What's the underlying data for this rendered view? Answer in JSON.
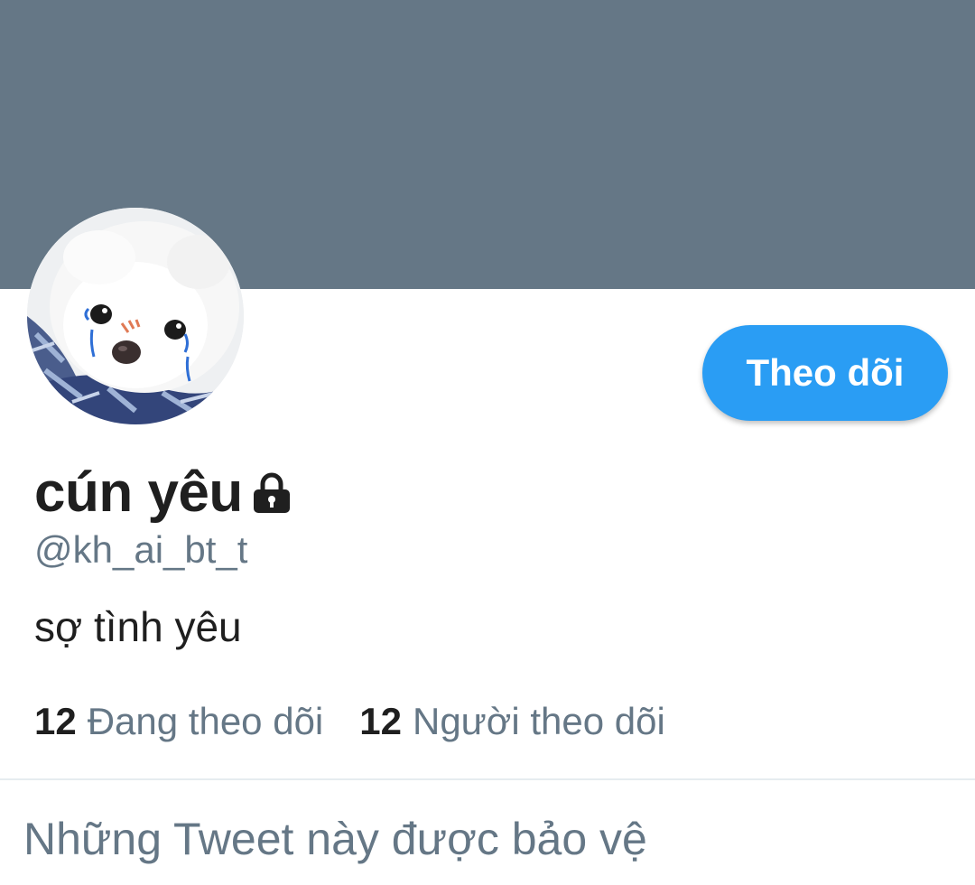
{
  "profile": {
    "display_name": "cún yêu",
    "handle": "@kh_ai_bt_t",
    "bio": "sợ tình yêu",
    "locked_icon": "lock-icon",
    "avatar_icon": "avatar-photo"
  },
  "actions": {
    "follow_label": "Theo dõi"
  },
  "stats": {
    "following_count": "12",
    "following_label": "Đang theo dõi",
    "followers_count": "12",
    "followers_label": "Người theo dõi"
  },
  "protected_notice": "Những Tweet này được bảo vệ",
  "colors": {
    "banner": "#657786",
    "accent": "#2a9df4",
    "secondary_text": "#657786",
    "primary_text": "#1f1f1f"
  }
}
